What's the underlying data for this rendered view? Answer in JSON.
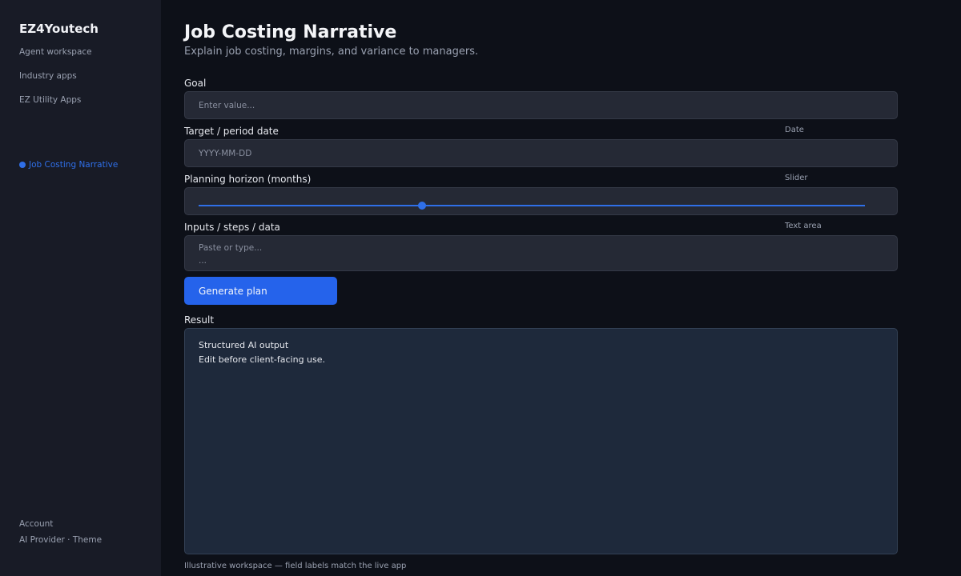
{
  "sidebar": {
    "brand": "EZ4Youtech",
    "nav": [
      "Agent workspace",
      "Industry apps",
      "EZ Utility Apps"
    ],
    "active_item": "Job Costing Narrative",
    "footer": [
      "Account",
      "AI Provider · Theme"
    ]
  },
  "page": {
    "title": "Job Costing Narrative",
    "subtitle": "Explain job costing, margins, and variance to managers."
  },
  "form": {
    "goal": {
      "label": "Goal",
      "placeholder": "Enter value..."
    },
    "date": {
      "label": "Target / period date",
      "type": "Date",
      "placeholder": "YYYY-MM-DD"
    },
    "horizon": {
      "label": "Planning horizon (months)",
      "type": "Slider",
      "value_fraction": 0.335
    },
    "inputs": {
      "label": "Inputs / steps / data",
      "type": "Text area",
      "placeholder": "Paste or type...\n..."
    },
    "submit_label": "Generate plan"
  },
  "result": {
    "label": "Result",
    "lines": [
      "Structured AI output",
      "Edit before client-facing use."
    ]
  },
  "footnote": "Illustrative workspace — field labels match the live app",
  "colors": {
    "accent": "#2563eb",
    "sidebar_bg": "#181b26",
    "main_bg": "#0d1018"
  }
}
